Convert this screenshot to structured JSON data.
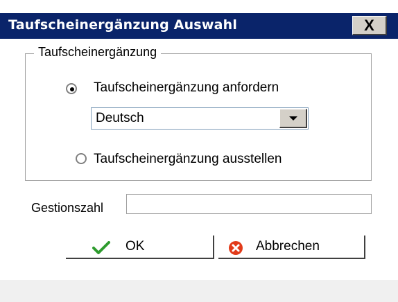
{
  "window": {
    "title": "Taufscheinergänzung Auswahl",
    "close_label": "X"
  },
  "group": {
    "legend": "Taufscheinergänzung",
    "options": [
      {
        "label": "Taufscheinergänzung anfordern",
        "selected": true
      },
      {
        "label": "Taufscheinergänzung ausstellen",
        "selected": false
      }
    ],
    "language_select": {
      "value": "Deutsch"
    }
  },
  "gestionszahl": {
    "label": "Gestionszahl",
    "value": ""
  },
  "buttons": {
    "ok": {
      "label": "OK",
      "icon": "checkmark-icon"
    },
    "cancel": {
      "label": "Abbrechen",
      "icon": "cancel-x-icon"
    }
  },
  "colors": {
    "title_bar": "#0a246a",
    "check_green": "#2e9b2e",
    "cancel_red": "#e23b1a"
  }
}
